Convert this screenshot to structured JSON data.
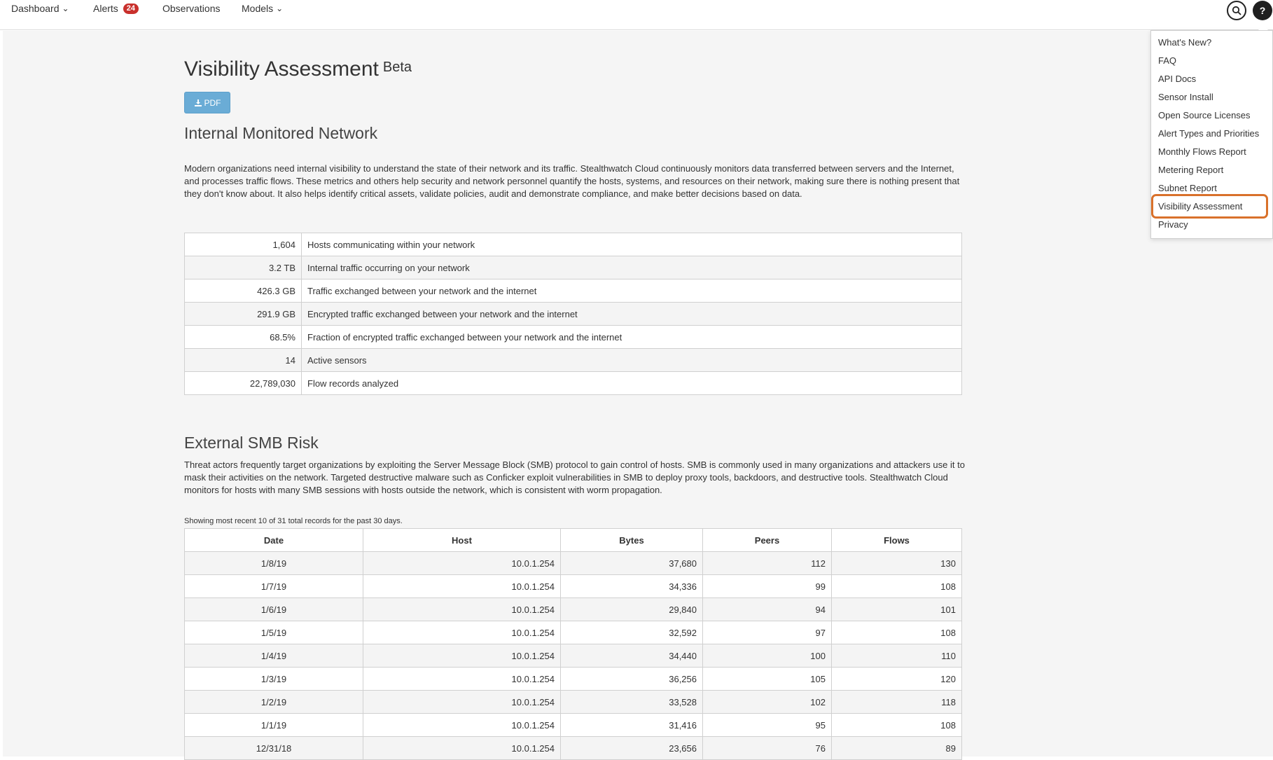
{
  "nav": {
    "items": [
      {
        "label": "Dashboard",
        "has_dropdown": true
      },
      {
        "label": "Alerts",
        "badge": "24"
      },
      {
        "label": "Observations"
      },
      {
        "label": "Models",
        "has_dropdown": true
      }
    ],
    "icons": [
      "search-icon",
      "help-icon"
    ],
    "help_icon_glyph": "?"
  },
  "page": {
    "title": "Visibility Assessment",
    "title_badge": "Beta",
    "pdf_button": "PDF"
  },
  "internal": {
    "heading": "Internal Monitored Network",
    "paragraph": "Modern organizations need internal visibility to understand the state of their network and its traffic. Stealthwatch Cloud continuously monitors data transferred between servers and the Internet, and processes traffic flows. These metrics and others help security and network personnel quantify the hosts, systems, and resources on their network, making sure there is nothing present that they don't know about. It also helps identify critical assets, validate policies, audit and demonstrate compliance, and make better decisions based on data.",
    "metrics": [
      {
        "value": "1,604",
        "label": "Hosts communicating within your network"
      },
      {
        "value": "3.2 TB",
        "label": "Internal traffic occurring on your network"
      },
      {
        "value": "426.3 GB",
        "label": "Traffic exchanged between your network and the internet"
      },
      {
        "value": "291.9 GB",
        "label": "Encrypted traffic exchanged between your network and the internet"
      },
      {
        "value": "68.5%",
        "label": "Fraction of encrypted traffic exchanged between your network and the internet"
      },
      {
        "value": "14",
        "label": "Active sensors"
      },
      {
        "value": "22,789,030",
        "label": "Flow records analyzed"
      }
    ]
  },
  "smb": {
    "heading": "External SMB Risk",
    "paragraph": "Threat actors frequently target organizations by exploiting the Server Message Block (SMB) protocol to gain control of hosts. SMB is commonly used in many organizations and attackers use it to mask their activities on the network. Targeted destructive malware such as Conficker exploit vulnerabilities in SMB to deploy proxy tools, backdoors, and destructive tools. Stealthwatch Cloud monitors for hosts with many SMB sessions with hosts outside the network, which is consistent with worm propagation.",
    "showing": "Showing most recent 10 of 31 total records for the past 30 days.",
    "columns": [
      "Date",
      "Host",
      "Bytes",
      "Peers",
      "Flows"
    ],
    "rows": [
      [
        "1/8/19",
        "10.0.1.254",
        "37,680",
        "112",
        "130"
      ],
      [
        "1/7/19",
        "10.0.1.254",
        "34,336",
        "99",
        "108"
      ],
      [
        "1/6/19",
        "10.0.1.254",
        "29,840",
        "94",
        "101"
      ],
      [
        "1/5/19",
        "10.0.1.254",
        "32,592",
        "97",
        "108"
      ],
      [
        "1/4/19",
        "10.0.1.254",
        "34,440",
        "100",
        "110"
      ],
      [
        "1/3/19",
        "10.0.1.254",
        "36,256",
        "105",
        "120"
      ],
      [
        "1/2/19",
        "10.0.1.254",
        "33,528",
        "102",
        "118"
      ],
      [
        "1/1/19",
        "10.0.1.254",
        "31,416",
        "95",
        "108"
      ],
      [
        "12/31/18",
        "10.0.1.254",
        "23,656",
        "76",
        "89"
      ]
    ]
  },
  "help_menu": {
    "items": [
      "What's New?",
      "FAQ",
      "API Docs",
      "Sensor Install",
      "Open Source Licenses",
      "Alert Types and Priorities",
      "Monthly Flows Report",
      "Metering Report",
      "Subnet Report",
      "Visibility Assessment",
      "Privacy"
    ],
    "highlighted": "Visibility Assessment",
    "highlight_color": "#d9712b"
  },
  "colors": {
    "pdf_button": "#6aacd6",
    "badge": "#c9302c",
    "background": "#f5f5f5"
  }
}
